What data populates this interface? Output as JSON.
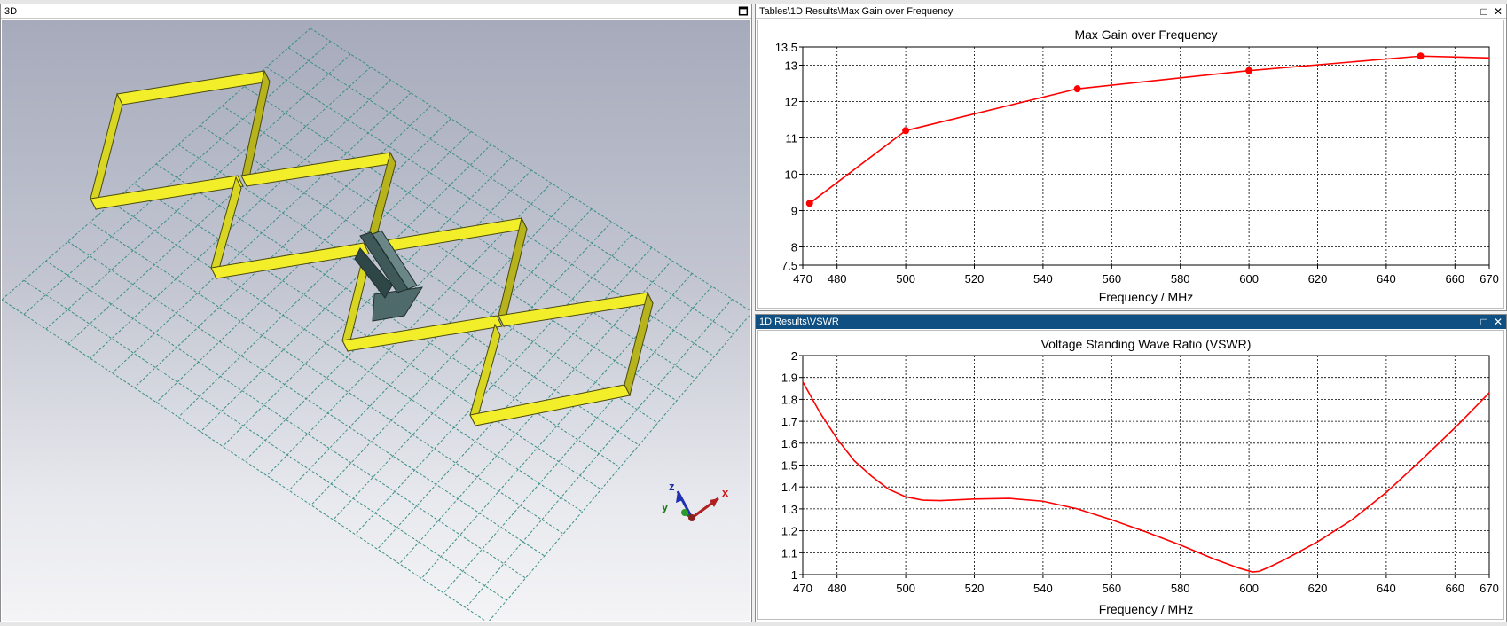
{
  "panel3d": {
    "title": "3D",
    "axes": {
      "x": "x",
      "y": "y",
      "z": "z"
    }
  },
  "gainPanel": {
    "title": "Tables\\1D Results\\Max Gain over Frequency"
  },
  "vswrPanel": {
    "title": "1D Results\\VSWR"
  },
  "icons": {
    "maximize": "maximize-icon",
    "close": "close-icon"
  },
  "colors": {
    "curve": "#ff0000",
    "antenna": "#f2ef2a",
    "grid3d": "#3a8f86",
    "activeTitle": "#0f4f82"
  },
  "chart_data": [
    {
      "type": "line",
      "title": "Max Gain over Frequency",
      "xlabel": "Frequency / MHz",
      "ylabel": "",
      "xlim": [
        470,
        670
      ],
      "ylim": [
        7.5,
        13.5
      ],
      "xticks": [
        470,
        480,
        500,
        520,
        540,
        560,
        580,
        600,
        620,
        640,
        660,
        670
      ],
      "yticks": [
        7.5,
        8,
        9,
        10,
        11,
        12,
        13,
        13.5
      ],
      "grid": true,
      "series": [
        {
          "x": [
            472,
            500,
            550,
            600,
            650,
            670
          ],
          "y": [
            9.2,
            11.2,
            12.35,
            12.85,
            13.25,
            13.2
          ],
          "markers": [
            [
              472,
              9.2
            ],
            [
              500,
              11.2
            ],
            [
              550,
              12.35
            ],
            [
              600,
              12.85
            ],
            [
              650,
              13.25
            ]
          ]
        }
      ]
    },
    {
      "type": "line",
      "title": "Voltage Standing Wave Ratio (VSWR)",
      "xlabel": "Frequency / MHz",
      "ylabel": "",
      "xlim": [
        470,
        670
      ],
      "ylim": [
        1,
        2
      ],
      "xticks": [
        470,
        480,
        500,
        520,
        540,
        560,
        580,
        600,
        620,
        640,
        660,
        670
      ],
      "yticks": [
        1,
        1.1,
        1.2,
        1.3,
        1.4,
        1.5,
        1.6,
        1.7,
        1.8,
        1.9,
        2
      ],
      "grid": true,
      "series": [
        {
          "x": [
            470,
            475,
            480,
            485,
            490,
            495,
            500,
            505,
            510,
            520,
            530,
            540,
            550,
            560,
            570,
            580,
            590,
            597,
            601,
            603,
            606,
            610,
            620,
            630,
            640,
            650,
            660,
            670
          ],
          "y": [
            1.88,
            1.74,
            1.62,
            1.52,
            1.45,
            1.39,
            1.355,
            1.34,
            1.338,
            1.345,
            1.348,
            1.335,
            1.3,
            1.25,
            1.195,
            1.135,
            1.07,
            1.03,
            1.012,
            1.015,
            1.035,
            1.065,
            1.15,
            1.25,
            1.375,
            1.52,
            1.67,
            1.83
          ]
        }
      ]
    }
  ]
}
